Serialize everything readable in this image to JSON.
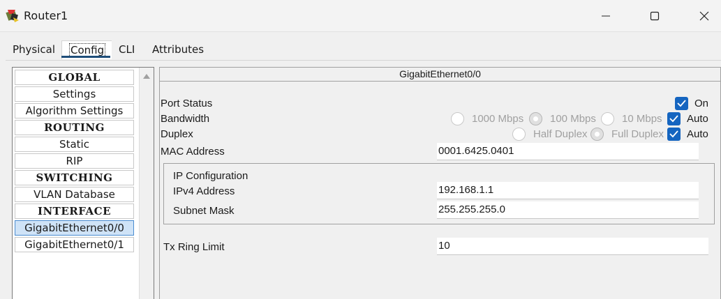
{
  "window": {
    "title": "Router1"
  },
  "tabs": [
    {
      "label": "Physical"
    },
    {
      "label": "Config"
    },
    {
      "label": "CLI"
    },
    {
      "label": "Attributes"
    }
  ],
  "active_tab": "Config",
  "sidebar": {
    "items": [
      {
        "label": "GLOBAL",
        "type": "header"
      },
      {
        "label": "Settings",
        "type": "item"
      },
      {
        "label": "Algorithm Settings",
        "type": "item"
      },
      {
        "label": "ROUTING",
        "type": "header"
      },
      {
        "label": "Static",
        "type": "item"
      },
      {
        "label": "RIP",
        "type": "item"
      },
      {
        "label": "SWITCHING",
        "type": "header"
      },
      {
        "label": "VLAN Database",
        "type": "item"
      },
      {
        "label": "INTERFACE",
        "type": "header"
      },
      {
        "label": "GigabitEthernet0/0",
        "type": "item",
        "selected": true
      },
      {
        "label": "GigabitEthernet0/1",
        "type": "item"
      }
    ]
  },
  "interface": {
    "name": "GigabitEthernet0/0",
    "port_status": {
      "label": "Port Status",
      "on_label": "On",
      "on": true
    },
    "bandwidth": {
      "label": "Bandwidth",
      "options": [
        "1000 Mbps",
        "100 Mbps",
        "10 Mbps"
      ],
      "selected": "100 Mbps",
      "auto_label": "Auto",
      "auto": true
    },
    "duplex": {
      "label": "Duplex",
      "options": [
        "Half Duplex",
        "Full Duplex"
      ],
      "selected": "Full Duplex",
      "auto_label": "Auto",
      "auto": true
    },
    "mac": {
      "label": "MAC Address",
      "value": "0001.6425.0401"
    },
    "ip_config": {
      "title": "IP Configuration",
      "ipv4_label": "IPv4 Address",
      "ipv4_value": "192.168.1.1",
      "mask_label": "Subnet Mask",
      "mask_value": "255.255.255.0"
    },
    "tx_ring": {
      "label": "Tx Ring Limit",
      "value": "10"
    }
  },
  "colors": {
    "accent": "#1565c0",
    "tab_underline": "#1f4e79",
    "selected_item": "#cfe3f7"
  }
}
